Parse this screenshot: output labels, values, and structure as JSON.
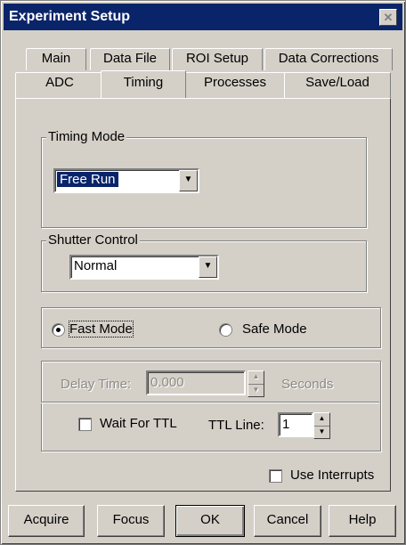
{
  "window": {
    "title": "Experiment Setup",
    "close_symbol": "✕"
  },
  "tabs_row1": [
    "Main",
    "Data File",
    "ROI Setup",
    "Data Corrections"
  ],
  "tabs_row2": [
    "ADC",
    "Timing",
    "Processes",
    "Save/Load"
  ],
  "active_tab": "Timing",
  "timing_mode": {
    "legend": "Timing Mode",
    "value": "Free Run"
  },
  "shutter_control": {
    "legend": "Shutter Control",
    "value": "Normal"
  },
  "mode": {
    "fast_label": "Fast Mode",
    "safe_label": "Safe Mode",
    "selected": "Fast Mode"
  },
  "delay": {
    "label": "Delay Time:",
    "value": "0.000",
    "unit": "Seconds"
  },
  "ttl": {
    "wait_label": "Wait For TTL",
    "wait_checked": false,
    "line_label": "TTL Line:",
    "line_value": "1"
  },
  "interrupts": {
    "label": "Use Interrupts",
    "checked": false
  },
  "buttons": {
    "acquire": "Acquire",
    "focus": "Focus",
    "ok": "OK",
    "cancel": "Cancel",
    "help": "Help"
  },
  "colors": {
    "title_bar": "#0a246a",
    "face": "#d4d0c8",
    "selection": "#0a246a"
  }
}
